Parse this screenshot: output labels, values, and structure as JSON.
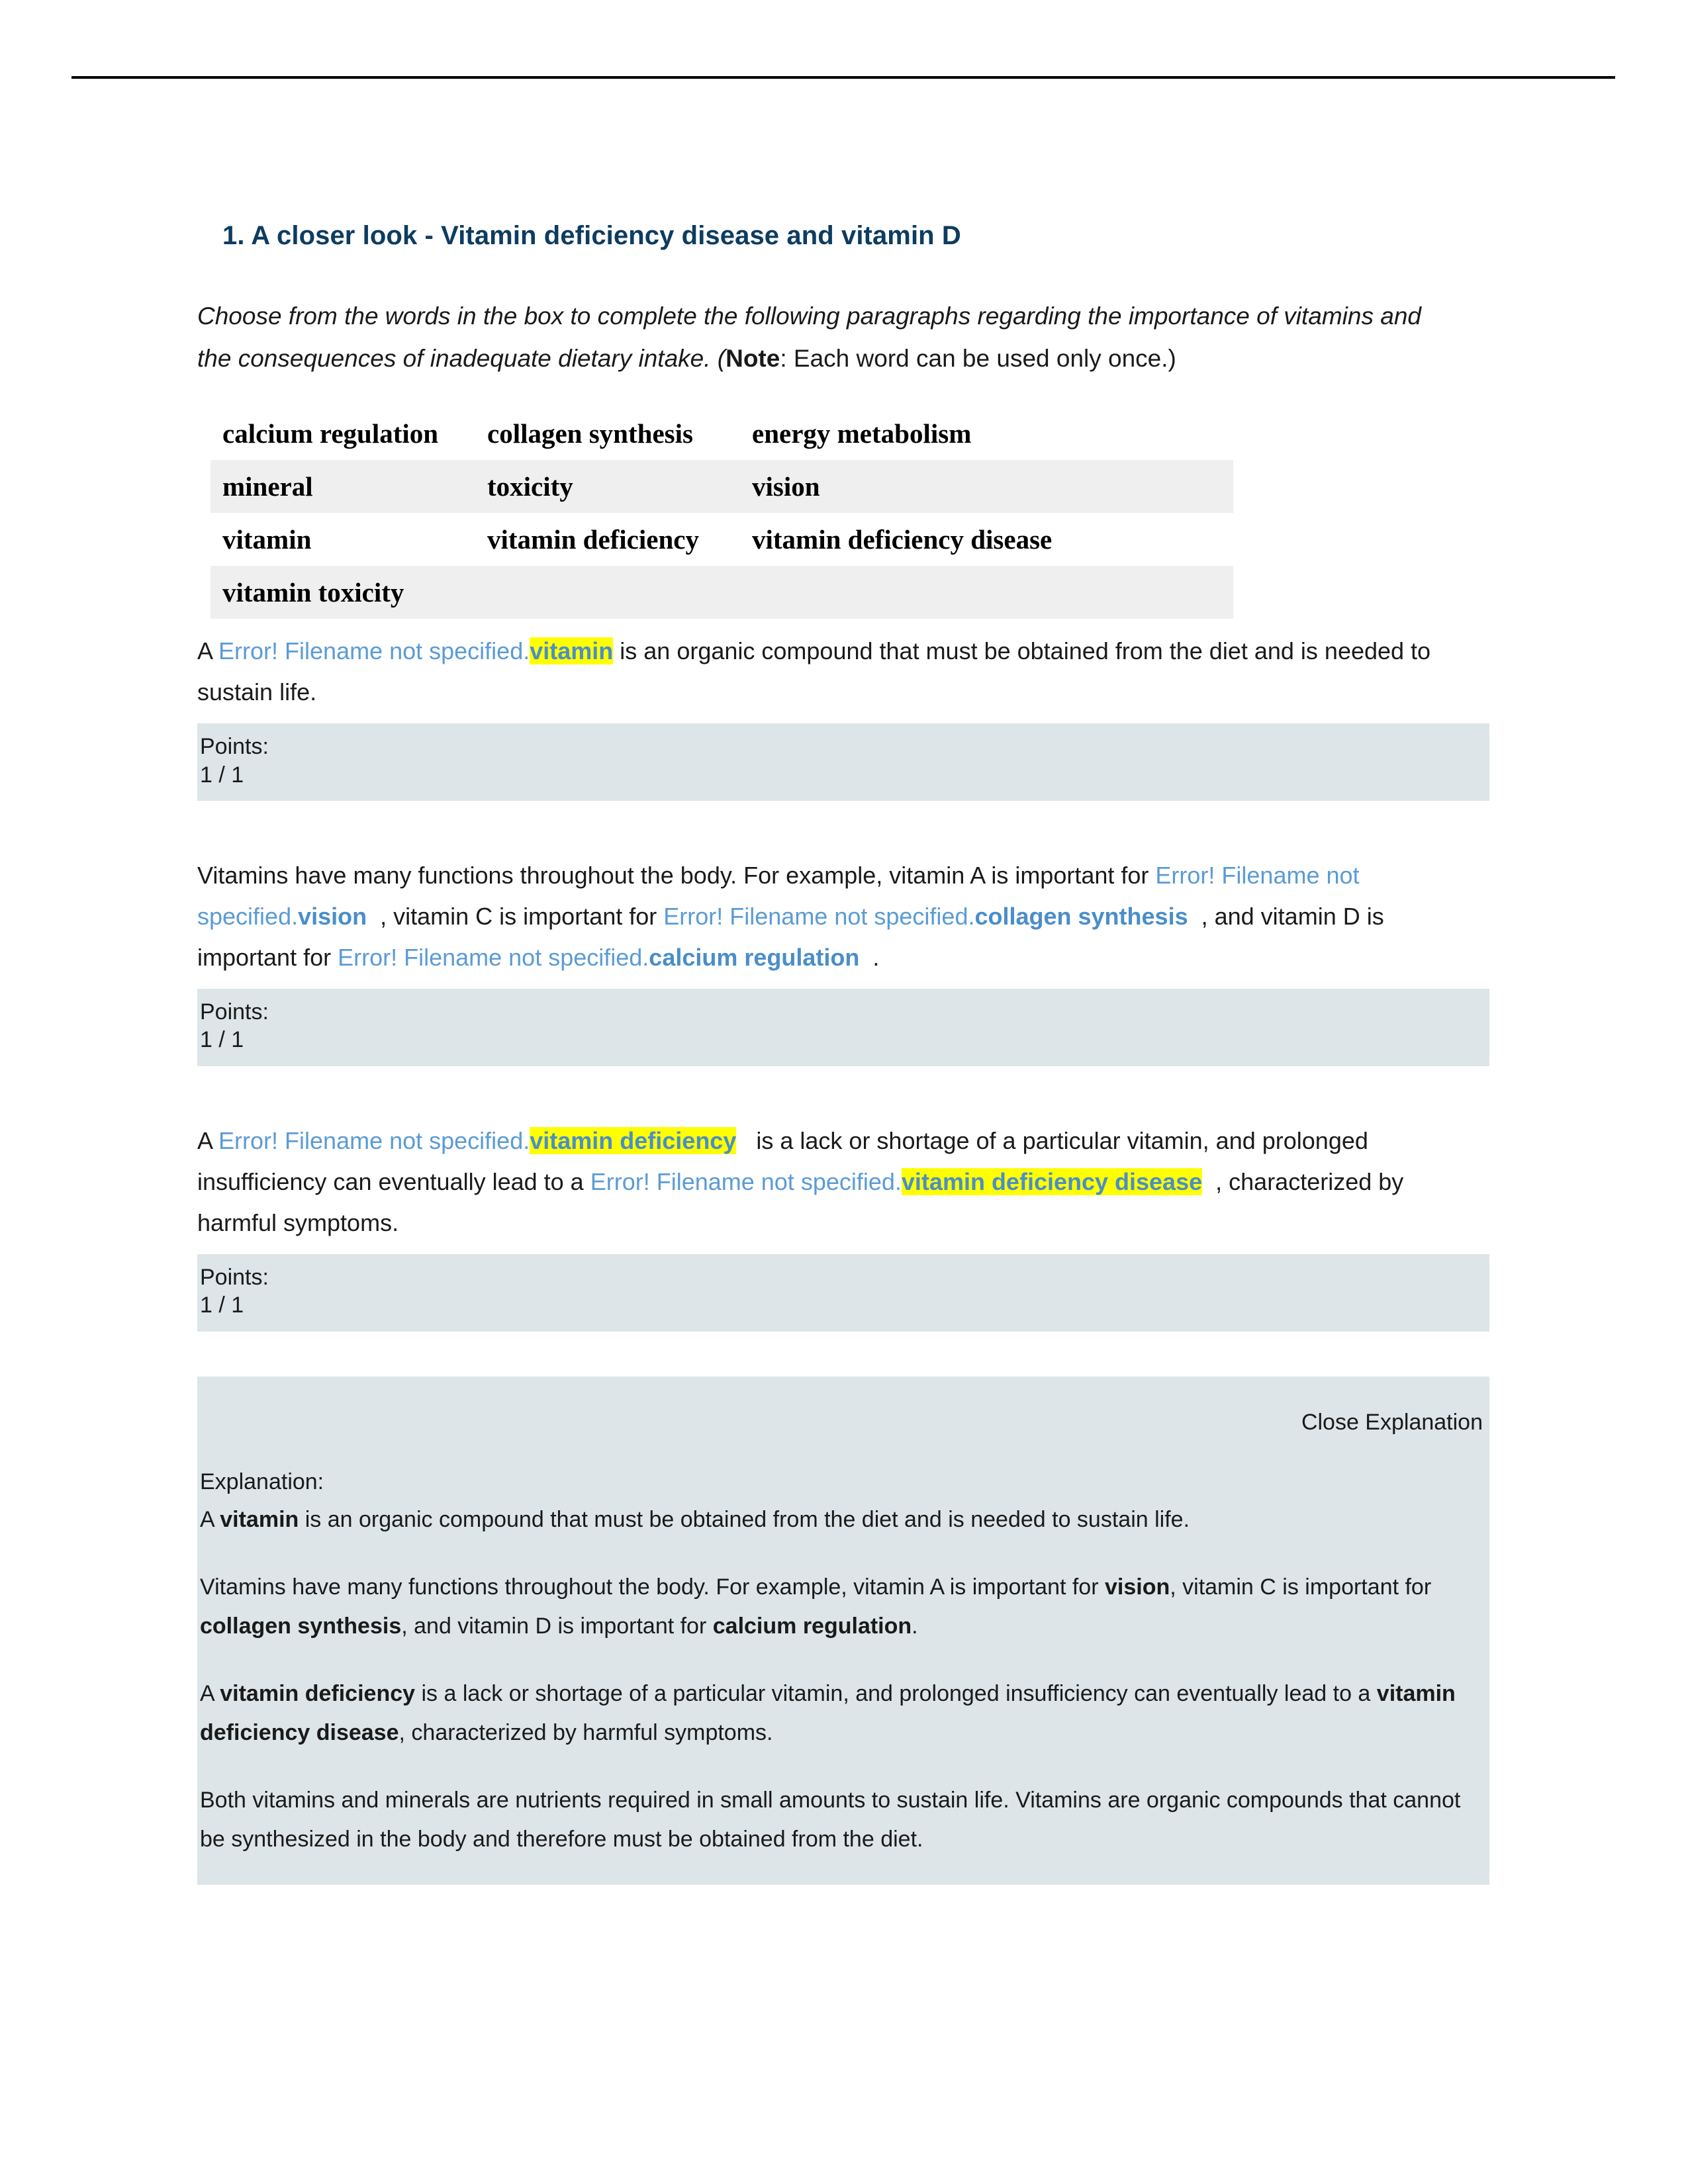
{
  "document": {
    "title": "1. A closer look - Vitamin deficiency disease and vitamin D",
    "title_color": "#0d3c61",
    "error_token": "Error! Filename not specified.",
    "intro": {
      "part1": "Choose from the words in the box to complete the following paragraphs regarding the importance of vitamins and the consequences of inadequate dietary intake. (",
      "note_bold": "Note",
      "part2": ": Each word can be used only once.)"
    },
    "wordbank": {
      "rows": [
        [
          "calcium regulation",
          "collagen synthesis",
          "energy metabolism"
        ],
        [
          "mineral",
          "toxicity",
          "vision"
        ],
        [
          "vitamin",
          "vitamin deficiency",
          "vitamin deficiency disease"
        ],
        [
          "vitamin toxicity",
          "",
          ""
        ]
      ]
    },
    "questions": [
      {
        "segments": {
          "lead": "A ",
          "answer": "vitamin",
          "tail": " is an organic compound that must be obtained from the diet and is needed to sustain life."
        },
        "points_label": "Points:",
        "points_value": "1 / 1"
      },
      {
        "segments": {
          "lead": "Vitamins have many functions throughout the body. For example, vitamin A is important for ",
          "answer1": "vision",
          "mid1": ", vitamin C is important for ",
          "answer2": "collagen synthesis",
          "mid2": ", and vitamin D is important for ",
          "answer3": "calcium regulation",
          "tail": "."
        },
        "points_label": "Points:",
        "points_value": "1 / 1"
      },
      {
        "segments": {
          "lead": "A ",
          "answer1": "vitamin deficiency",
          "mid1": " is a lack or shortage of a particular vitamin, and prolonged insufficiency can eventually lead to a ",
          "answer2": "vitamin deficiency disease",
          "tail": ", characterized by harmful symptoms."
        },
        "points_label": "Points:",
        "points_value": "1 / 1"
      }
    ],
    "explanation": {
      "close_label": "Close Explanation",
      "label": "Explanation:",
      "p1": {
        "lead": "A ",
        "bold": "vitamin",
        "tail": " is an organic compound that must be obtained from the diet and is needed to sustain life."
      },
      "p2": {
        "lead": "Vitamins have many functions throughout the body. For example, vitamin A is important for ",
        "bold1": "vision",
        "mid1": ", vitamin C is important for ",
        "bold2": "collagen synthesis",
        "mid2": ", and vitamin D is important for ",
        "bold3": "calcium regulation",
        "tail": "."
      },
      "p3": {
        "lead": "A ",
        "bold1": "vitamin deficiency",
        "mid1": " is a lack or shortage of a particular vitamin, and prolonged insufficiency can eventually lead to a ",
        "bold2": "vitamin deficiency disease",
        "tail": ", characterized by harmful symptoms."
      },
      "p4": "Both vitamins and minerals are nutrients required in small amounts to sustain life. Vitamins are organic compounds that cannot be synthesized in the body and therefore must be obtained from the diet."
    },
    "colors": {
      "title_blue": "#0d3c61",
      "link_blue": "#5b9bd5",
      "answer_blue": "#4a8ec9",
      "highlight_yellow": "#ffff00",
      "points_bg": "#dde5e8",
      "table_shade": "#efefef"
    }
  }
}
